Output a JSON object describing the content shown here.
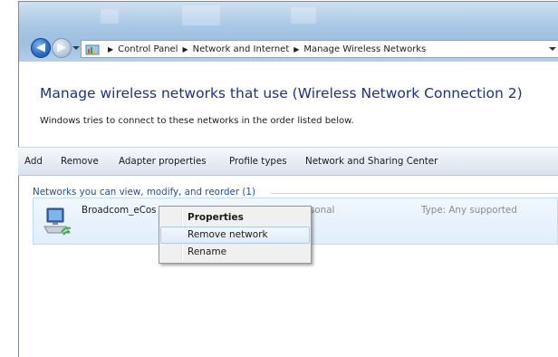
{
  "breadcrumb": {
    "items": [
      "Control Panel",
      "Network and Internet",
      "Manage Wireless Networks"
    ]
  },
  "content": {
    "title": "Manage wireless networks that use (Wireless Network Connection 2)",
    "subtitle": "Windows tries to connect to these networks in the order listed below."
  },
  "toolbar": {
    "add": "Add",
    "remove": "Remove",
    "adapter_properties": "Adapter properties",
    "profile_types": "Profile types",
    "network_sharing_center": "Network and Sharing Center"
  },
  "networks": {
    "group_header": "Networks you can view, modify, and reorder (1)",
    "items": [
      {
        "name": "Broadcom_eCos",
        "security": "sonal",
        "type": "Type: Any supported"
      }
    ]
  },
  "context_menu": {
    "items": [
      "Properties",
      "Remove network",
      "Rename"
    ],
    "default_item": "Properties",
    "highlighted_item": "Remove network"
  },
  "colors": {
    "title_blue": "#1e3287",
    "group_header_blue": "#1f4fa5",
    "selection_blue": "#e0eefc"
  }
}
